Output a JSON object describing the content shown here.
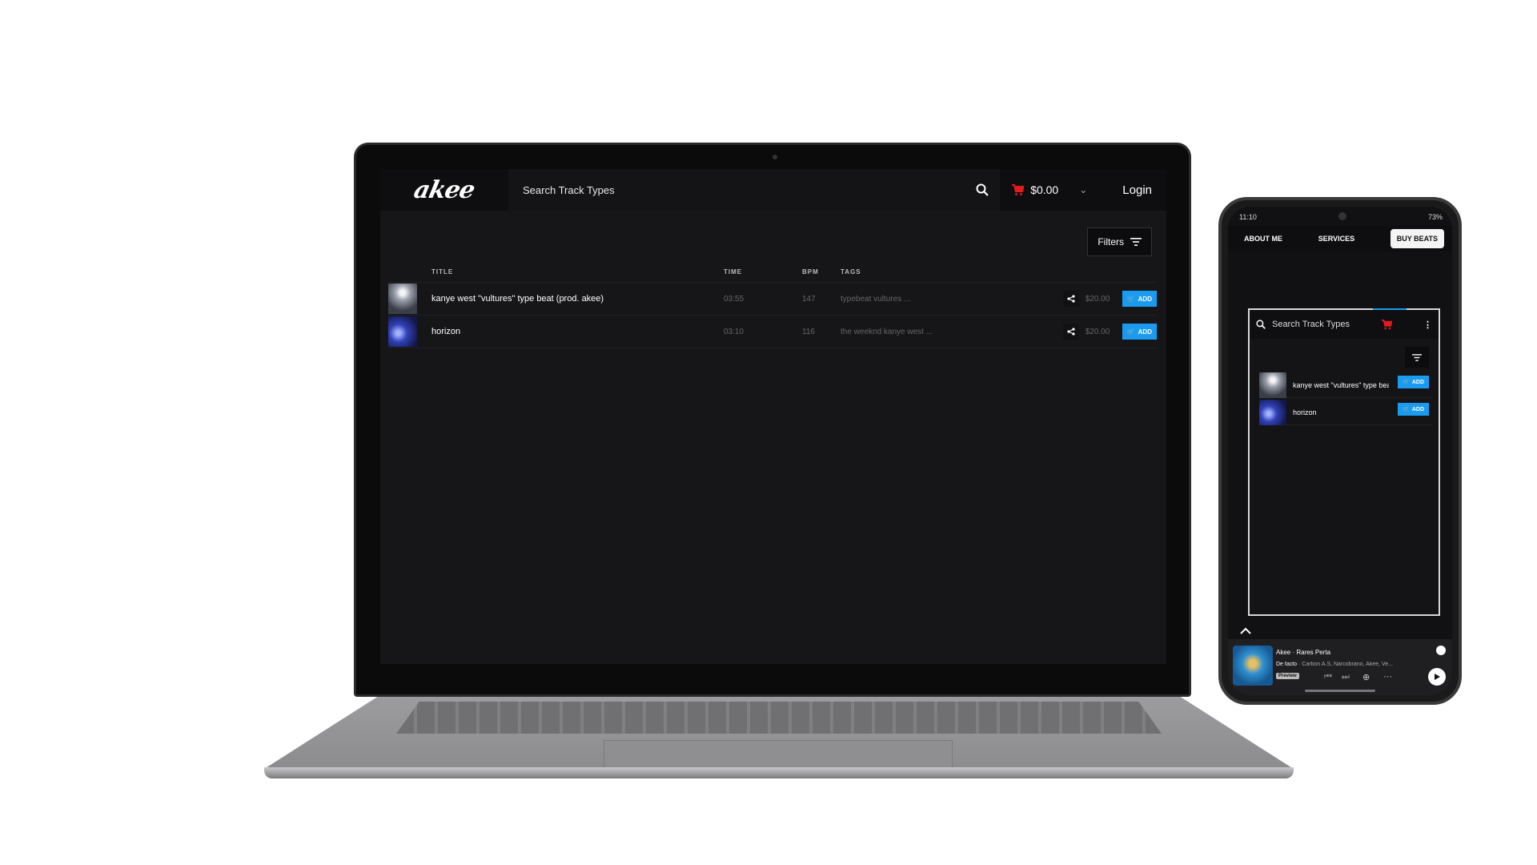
{
  "laptop": {
    "header": {
      "logo_text": "akee",
      "search_placeholder": "Search Track Types",
      "cart_total": "$0.00",
      "login_label": "Login"
    },
    "filters_label": "Filters",
    "table": {
      "headers": {
        "title": "TITLE",
        "time": "TIME",
        "bpm": "BPM",
        "tags": "TAGS"
      },
      "rows": [
        {
          "title": "kanye west \"vultures\" type beat (prod. akee)",
          "time": "03:55",
          "bpm": "147",
          "tags": "typebeat vultures ...",
          "price": "$20.00",
          "add_label": "ADD"
        },
        {
          "title": "horizon",
          "time": "03:10",
          "bpm": "116",
          "tags": "the weeknd kanye west ...",
          "price": "$20.00",
          "add_label": "ADD"
        }
      ]
    }
  },
  "phone": {
    "status": {
      "time": "11:10",
      "battery": "73%"
    },
    "nav": [
      {
        "label": "ABOUT ME"
      },
      {
        "label": "SERVICES"
      },
      {
        "label": "BUY BEATS"
      }
    ],
    "embed": {
      "search_placeholder": "Search Track Types",
      "rows": [
        {
          "title": "kanye west \"vultures\" type beat (prod. akee)",
          "add_label": "ADD"
        },
        {
          "title": "horizon",
          "add_label": "ADD"
        }
      ]
    },
    "player": {
      "title": "Akee · Rares Perta",
      "track": "De facto",
      "artists": "· Carbon A.S, Narcobrano, Akee, Ve...",
      "preview_label": "Preview"
    }
  },
  "colors": {
    "accent_blue": "#1a9bf0",
    "cart_red": "#e01b1b",
    "app_bg": "#161619"
  }
}
